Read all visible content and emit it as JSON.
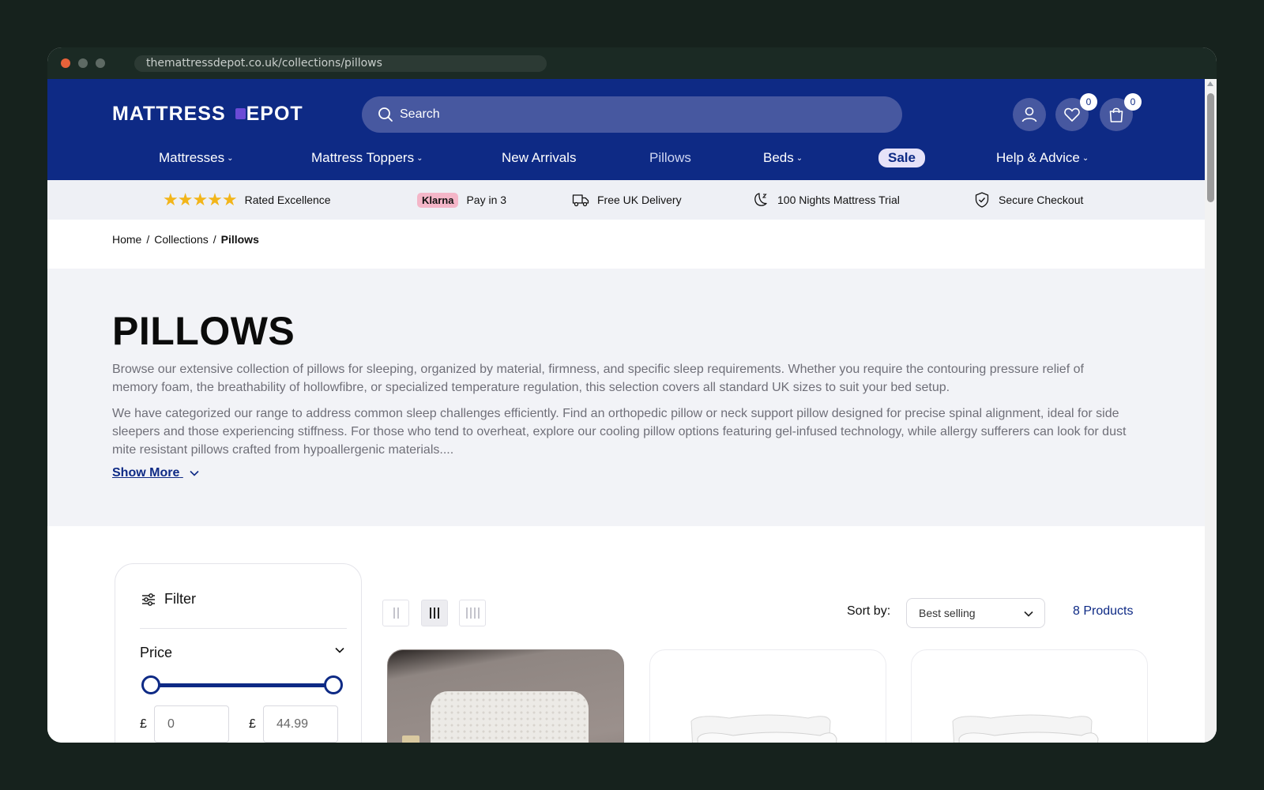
{
  "browser": {
    "url": "themattressdepot.co.uk/collections/pillows"
  },
  "header": {
    "logo": [
      "MATTRESS ",
      "EPOT"
    ],
    "search_placeholder": "Search",
    "wishlist_count": "0",
    "cart_count": "0"
  },
  "nav": {
    "items": [
      {
        "label": "Mattresses",
        "dropdown": true
      },
      {
        "label": "Mattress Toppers",
        "dropdown": true
      },
      {
        "label": "New Arrivals",
        "dropdown": false
      },
      {
        "label": "Pillows",
        "dropdown": false
      },
      {
        "label": "Beds",
        "dropdown": true
      },
      {
        "label": "Sale",
        "dropdown": false
      },
      {
        "label": "Help & Advice",
        "dropdown": true
      }
    ]
  },
  "usp": {
    "rating": "Rated Excellence",
    "klarna_logo": "Klarna",
    "klarna_text": "Pay in 3",
    "delivery": "Free UK Delivery",
    "trial": "100 Nights Mattress Trial",
    "checkout": "Secure Checkout"
  },
  "breadcrumb": [
    "Home",
    "Collections",
    "Pillows"
  ],
  "collection": {
    "title": "PILLOWS",
    "description_1": "Browse our extensive collection of pillows for sleeping, organized by material, firmness, and specific sleep requirements. Whether you require the contouring pressure relief of memory foam, the breathability of hollowfibre, or specialized temperature regulation, this selection covers all standard UK sizes to suit your bed setup.",
    "description_2": "We have categorized our range to address common sleep challenges efficiently. Find an orthopedic pillow or neck support pillow designed for precise spinal alignment, ideal for side sleepers and those experiencing stiffness. For those who tend to overheat, explore our cooling pillow options featuring gel-infused technology, while allergy sufferers can look for dust mite resistant pillows crafted from hypoallergenic materials....",
    "show_more": "Show More"
  },
  "filter": {
    "title": "Filter",
    "price_label": "Price",
    "currency": "£",
    "min_value": "0",
    "max_value": "44.99"
  },
  "toolbar": {
    "sort_label": "Sort by:",
    "sort_value": "Best selling",
    "product_count": "8 Products"
  },
  "colors": {
    "brand_navy": "#0e2a85",
    "search_bg": "#4758a0",
    "usp_bg": "#eef0f5",
    "intro_bg": "#f2f3f7",
    "star": "#f2b51a",
    "klarna": "#f4b6c8",
    "sale_pill": "#e6e2f8"
  },
  "icons": {
    "search": "search-icon",
    "account": "user-icon",
    "wishlist": "heart-icon",
    "cart": "bag-icon",
    "delivery": "truck-icon",
    "trial": "moon-icon",
    "checkout": "shield-check-icon",
    "filter": "sliders-icon"
  }
}
